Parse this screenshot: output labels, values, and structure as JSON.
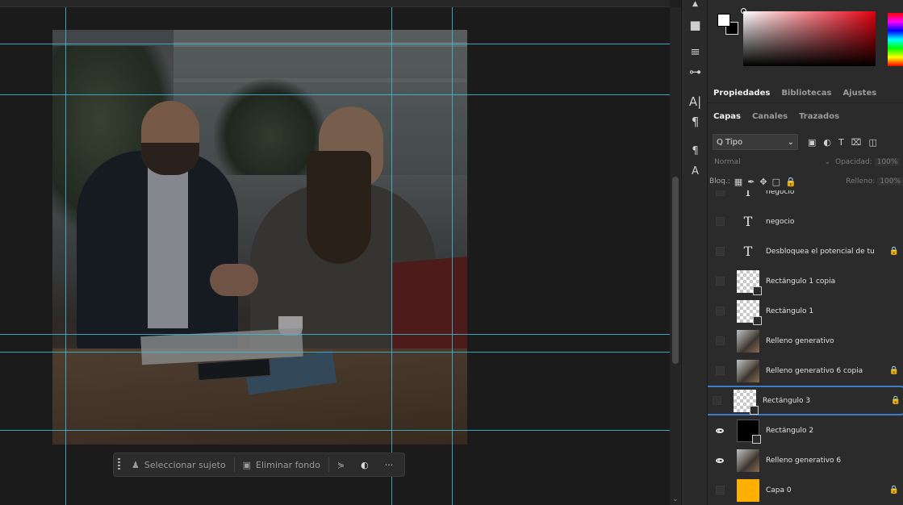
{
  "taskbar": {
    "select_subject": "Seleccionar sujeto",
    "remove_bg": "Eliminar fondo",
    "more": "···"
  },
  "panel_tabs": {
    "row1": [
      "Propiedades",
      "Bibliotecas",
      "Ajustes"
    ],
    "row2": [
      "Capas",
      "Canales",
      "Trazados"
    ]
  },
  "layers_panel": {
    "filter_label": "Q Tipo",
    "blend_mode": "Normal",
    "opacity_label": "Opacidad:",
    "opacity_value": "100%",
    "lock_label": "Bloq.:",
    "fill_label": "Relleno:",
    "fill_value": "100%"
  },
  "layers": [
    {
      "name": "negocio",
      "type": "text",
      "visible": false,
      "locked": false,
      "partial": true
    },
    {
      "name": "negocio",
      "type": "text",
      "visible": false,
      "locked": false
    },
    {
      "name": "Desbloquea el potencial de tu",
      "type": "text",
      "visible": false,
      "locked": true
    },
    {
      "name": "Rectángulo 1 copia",
      "type": "shape-transparent",
      "visible": false,
      "locked": false
    },
    {
      "name": "Rectángulo 1",
      "type": "shape-transparent",
      "visible": false,
      "locked": false
    },
    {
      "name": "Relleno generativo",
      "type": "photo",
      "visible": false,
      "locked": false
    },
    {
      "name": "Relleno generativo 6 copia",
      "type": "photo",
      "visible": false,
      "locked": true
    },
    {
      "name": "Rectángulo 3",
      "type": "shape-transparent",
      "visible": false,
      "locked": true,
      "selected": true
    },
    {
      "name": "Rectángulo 2",
      "type": "shape-black",
      "visible": true,
      "locked": false
    },
    {
      "name": "Relleno generativo 6",
      "type": "photo",
      "visible": true,
      "locked": false
    },
    {
      "name": "Capa 0",
      "type": "fill-orange",
      "visible": false,
      "locked": true
    }
  ],
  "colors": {
    "accent_selection": "#3d7cc9",
    "guide": "#3fb9d6",
    "layer_fill_orange": "#ffb000"
  }
}
